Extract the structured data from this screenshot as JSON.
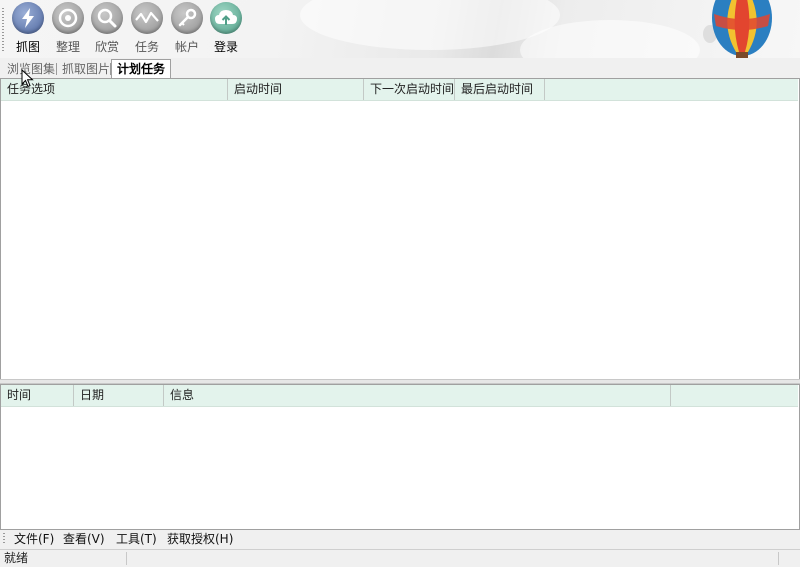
{
  "toolbar": {
    "items": [
      {
        "label": "抓图",
        "icon": "lightning-icon"
      },
      {
        "label": "整理",
        "icon": "eye-icon"
      },
      {
        "label": "欣赏",
        "icon": "magnifier-icon"
      },
      {
        "label": "任务",
        "icon": "pulse-icon"
      },
      {
        "label": "帐户",
        "icon": "key-icon"
      },
      {
        "label": "登录",
        "icon": "cloud-upload-icon"
      }
    ]
  },
  "tabs": [
    {
      "label": "浏览图集"
    },
    {
      "label": "抓取图片"
    },
    {
      "label": "计划任务",
      "selected": true
    }
  ],
  "task_table": {
    "columns": [
      "任务选项",
      "启动时间",
      "下一次启动时间",
      "最后启动时间",
      ""
    ]
  },
  "log_table": {
    "columns": [
      "时间",
      "日期",
      "信息",
      ""
    ]
  },
  "menubar": {
    "items": [
      "文件(F)",
      "查看(V)",
      "工具(T)",
      "获取授权(H)"
    ]
  },
  "status": {
    "text": "就绪"
  },
  "colors": {
    "header_bg": "#e3f3ec",
    "window_bg": "#f0f0f0"
  }
}
